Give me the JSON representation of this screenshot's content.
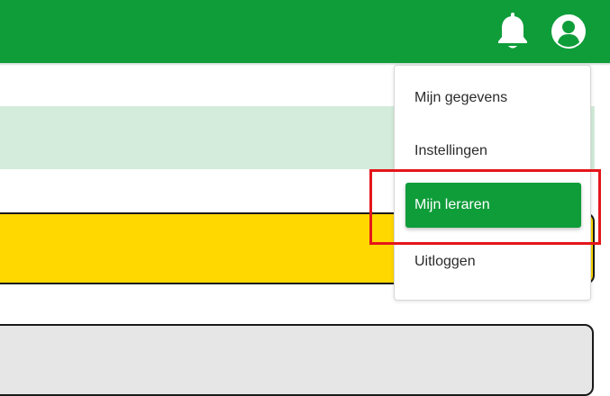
{
  "topbar": {
    "color": "#0f9d3a",
    "notification_icon": "bell-icon",
    "account_icon": "user-circle-icon"
  },
  "dropdown": {
    "items": [
      {
        "label": "Mijn gegevens",
        "active": false
      },
      {
        "label": "Instellingen",
        "active": false
      },
      {
        "label": "Mijn leraren",
        "active": true
      },
      {
        "label": "Uitloggen",
        "active": false
      }
    ]
  },
  "colors": {
    "accent": "#0f9d3a",
    "light_green_band": "#d4ecdb",
    "yellow_card": "#ffd800",
    "grey_card": "#e6e6e6",
    "highlight": "#e4161b"
  }
}
